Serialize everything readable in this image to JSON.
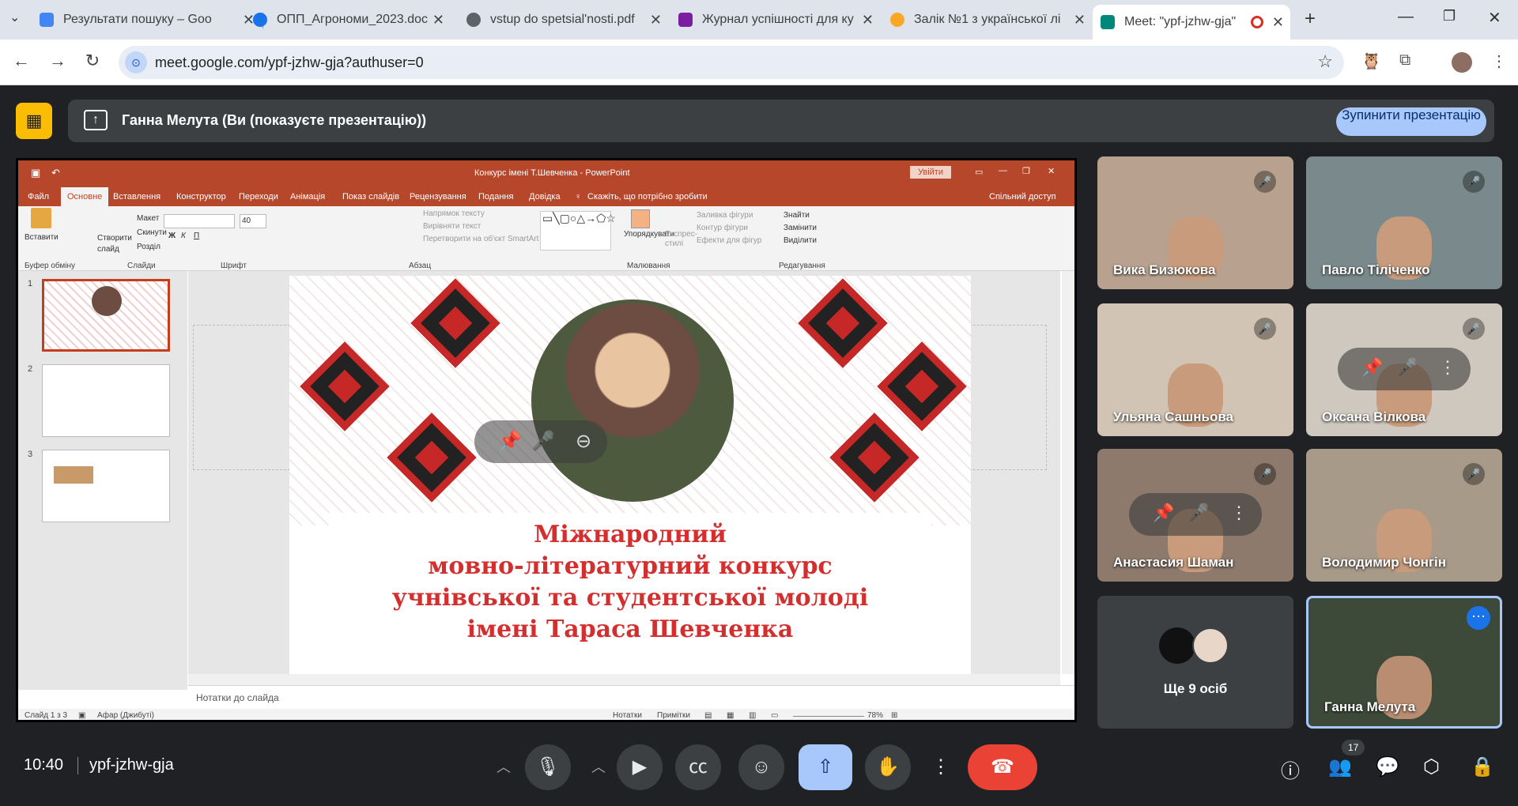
{
  "browser": {
    "tabs": [
      {
        "title": "Результати пошуку – Goo",
        "favicon_color": "#4285f4"
      },
      {
        "title": "ОПП_Агрономи_2023.doc",
        "favicon_color": "#1a73e8"
      },
      {
        "title": "vstup do spetsial'nosti.pdf",
        "favicon_color": "#5f6368"
      },
      {
        "title": "Журнал успішності для ку",
        "favicon_color": "#7b1fa2"
      },
      {
        "title": "Залік №1 з української лі",
        "favicon_color": "#f9a825"
      },
      {
        "title": "Meet: \"ypf-jzhw-gja\"",
        "favicon_color": "#00897b"
      }
    ],
    "url": "meet.google.com/ypf-jzhw-gja?authuser=0"
  },
  "presenting": {
    "text": "Ганна Мелута (Ви (показуєте презентацію))",
    "stop_label": "Зупинити презентацію"
  },
  "powerpoint": {
    "title": "Конкурс імені Т.Шевченка - PowerPoint",
    "login": "Увійти",
    "share": "Спільний доступ",
    "menu": [
      "Файл",
      "Основне",
      "Вставлення",
      "Конструктор",
      "Переходи",
      "Анімація",
      "Показ слайдів",
      "Рецензування",
      "Подання",
      "Довідка"
    ],
    "tell_me": "Скажіть, що потрібно зробити",
    "ribbon": {
      "paste": "Вставити",
      "clipboard_group": "Буфер обміну",
      "new_slide": "Створити слайд",
      "layout": "Макет",
      "reset": "Скинути",
      "section": "Розділ",
      "slides_group": "Слайди",
      "font_group": "Шрифт",
      "font_size": "40",
      "text_direction": "Напрямок тексту",
      "align_text": "Вирівняти текст",
      "smartart": "Перетворити на об'єкт SmartArt",
      "paragraph_group": "Абзац",
      "arrange": "Упорядкувати",
      "quick_styles": "Експрес-стилі",
      "shape_fill": "Заливка фігури",
      "shape_outline": "Контур фігури",
      "shape_effects": "Ефекти для фігур",
      "drawing_group": "Малювання",
      "find": "Знайти",
      "replace": "Замінити",
      "select": "Виділити",
      "editing_group": "Редагування"
    },
    "slide_numbers": [
      "1",
      "2",
      "3"
    ],
    "slide_text": [
      "Міжнародний",
      "мовно-літературний конкурс",
      "учнівської та студентської молоді",
      "імені Тараса Шевченка"
    ],
    "notes_placeholder": "Нотатки до слайда",
    "status": {
      "slide_count": "Слайд 1 з 3",
      "language": "Афар (Джибуті)",
      "notes": "Нотатки",
      "comments": "Примітки",
      "zoom": "78%"
    }
  },
  "participants": [
    {
      "name": "Вика Бизюкова",
      "bg": "#b8a28f"
    },
    {
      "name": "Павло Тіліченко",
      "bg": "#7a8a8c"
    },
    {
      "name": "Ульяна Сашньова",
      "bg": "#d2c4b4"
    },
    {
      "name": "Оксана Вілкова",
      "bg": "#cfc8be"
    },
    {
      "name": "Анастасия Шаман",
      "bg": "#8d7a6c"
    },
    {
      "name": "Володимир Чонгін",
      "bg": "#a79a88"
    }
  ],
  "more_people": "Ще 9 осіб",
  "self_tile": {
    "name": "Ганна Мелута",
    "bg": "#3d4a3a"
  },
  "bottom_bar": {
    "time": "10:40",
    "meeting_code": "ypf-jzhw-gja",
    "participant_count": "17"
  }
}
